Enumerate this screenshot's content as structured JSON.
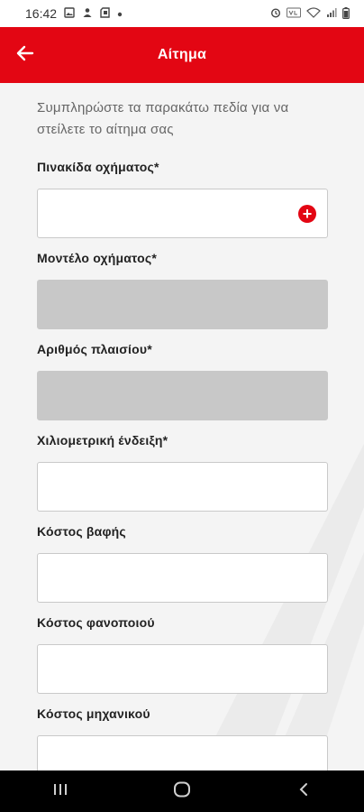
{
  "status_bar": {
    "time": "16:42",
    "icons_left": [
      "gallery-icon",
      "person-icon",
      "sd-card-icon",
      "dot-icon"
    ],
    "icons_right": [
      "alarm-icon",
      "volte-icon",
      "wifi-icon",
      "signal-icon",
      "battery-icon"
    ]
  },
  "app_bar": {
    "title": "Αίτημα",
    "back_icon": "arrow-left-icon",
    "color": "#e30613"
  },
  "form": {
    "intro": "Συμπληρώστε τα παρακάτω πεδία για να στείλετε το αίτημα σας",
    "fields": [
      {
        "label": "Πινακίδα οχήματος*",
        "value": "",
        "disabled": false,
        "action_icon": "plus-circle-icon"
      },
      {
        "label": "Μοντέλο οχήματος*",
        "value": "",
        "disabled": true
      },
      {
        "label": "Αριθμός πλαισίου*",
        "value": "",
        "disabled": true
      },
      {
        "label": "Χιλιομετρική ένδειξη*",
        "value": "",
        "disabled": false
      },
      {
        "label": "Κόστος βαφής",
        "value": "",
        "disabled": false
      },
      {
        "label": "Κόστος φανοποιού",
        "value": "",
        "disabled": false
      },
      {
        "label": "Κόστος μηχανικού",
        "value": "",
        "disabled": false
      }
    ]
  },
  "nav_bar": {
    "buttons": [
      "recent-apps-icon",
      "home-icon",
      "back-icon"
    ]
  }
}
